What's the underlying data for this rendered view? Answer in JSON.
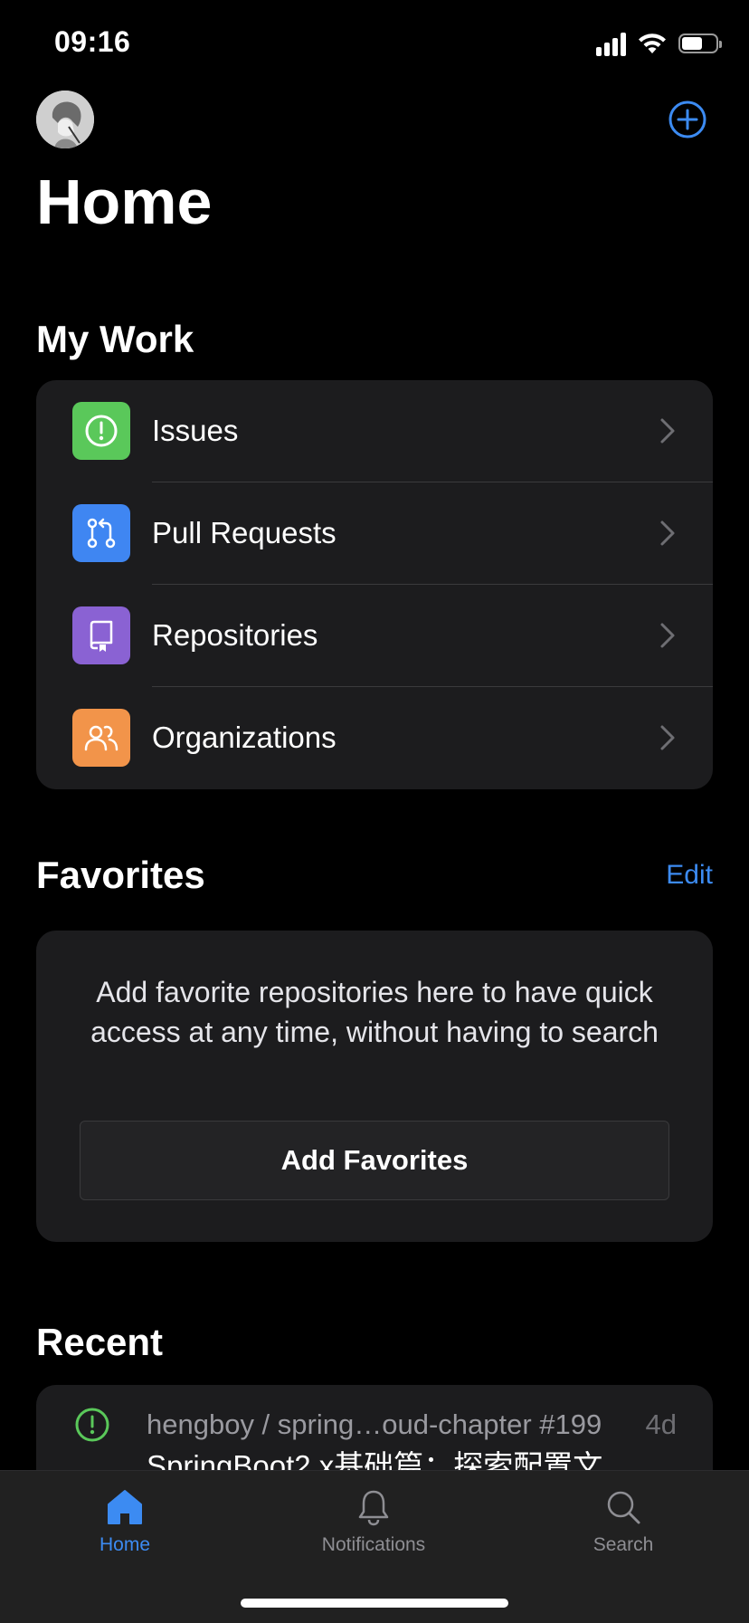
{
  "status_bar": {
    "time": "09:16",
    "battery_level": 0.6
  },
  "header": {
    "title": "Home",
    "avatar_icon": "user-avatar",
    "add_icon": "plus-circle-icon",
    "accent_color": "#3c8bf2"
  },
  "my_work": {
    "title": "My Work",
    "items": [
      {
        "label": "Issues",
        "icon": "issue-opened-icon",
        "color": "#5ac85a"
      },
      {
        "label": "Pull Requests",
        "icon": "git-pull-request-icon",
        "color": "#3f86f2"
      },
      {
        "label": "Repositories",
        "icon": "repo-icon",
        "color": "#8a62d3"
      },
      {
        "label": "Organizations",
        "icon": "people-icon",
        "color": "#f2944a"
      }
    ]
  },
  "favorites": {
    "title": "Favorites",
    "edit_label": "Edit",
    "empty_text": "Add favorite repositories here to have quick access at any time, without having to search",
    "button_label": "Add Favorites"
  },
  "recent": {
    "title": "Recent",
    "items": [
      {
        "repo": "hengboy / spring…oud-chapter #199",
        "age": "4d",
        "subject": "SpringBoot2.x基础篇：探索配置文",
        "icon": "issue-opened-icon",
        "icon_color": "#5ac85a"
      }
    ]
  },
  "tabbar": {
    "tabs": [
      {
        "label": "Home",
        "icon": "home-icon",
        "active": true
      },
      {
        "label": "Notifications",
        "icon": "bell-icon",
        "active": false
      },
      {
        "label": "Search",
        "icon": "search-icon",
        "active": false
      }
    ]
  }
}
